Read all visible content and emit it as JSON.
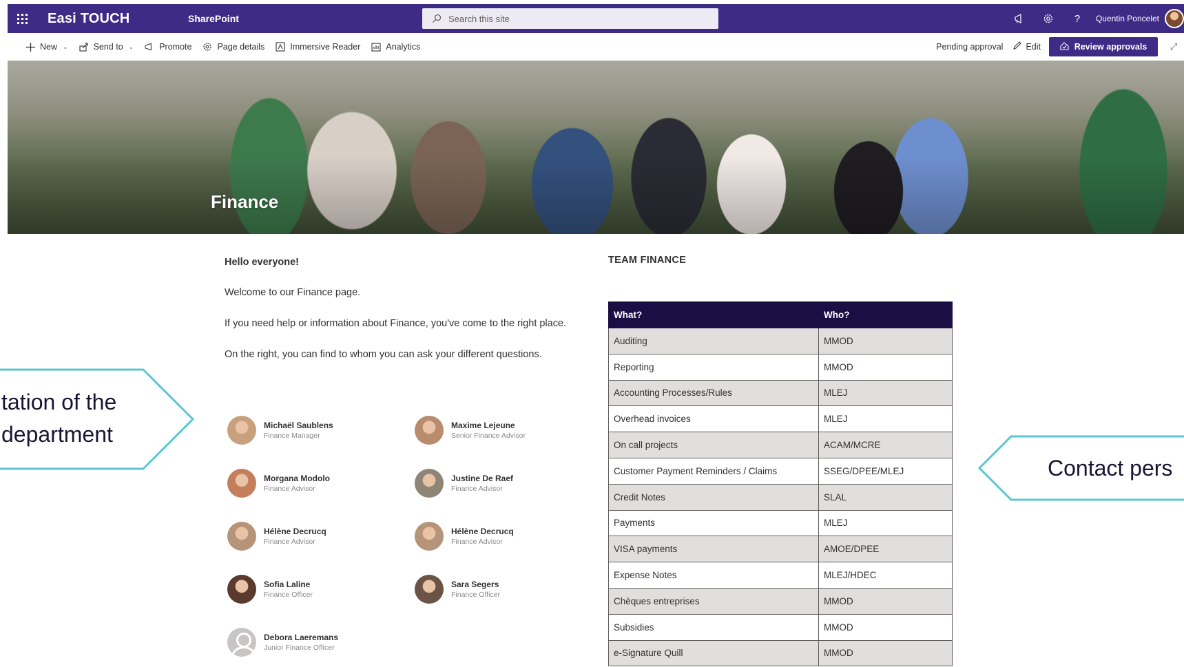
{
  "suite": {
    "brand": "Easi TOUCH",
    "app": "SharePoint",
    "search_placeholder": "Search this site",
    "user_name": "Quentin Poncelet",
    "help_label": "?"
  },
  "commands": {
    "new": "New",
    "send_to": "Send to",
    "promote": "Promote",
    "page_details": "Page details",
    "immersive_reader": "Immersive Reader",
    "analytics": "Analytics",
    "pending": "Pending approval",
    "edit": "Edit",
    "review": "Review approvals"
  },
  "hero": {
    "title": "Finance"
  },
  "intro": {
    "heading": "Hello everyone!",
    "p1": "Welcome to our Finance page.",
    "p2": "If you need help or information about Finance, you've come to the right place.",
    "p3": "On the right, you can find to whom you can ask your different questions."
  },
  "people": [
    {
      "name": "Michaël Saublens",
      "role": "Finance Manager",
      "tone": "#c9a07e"
    },
    {
      "name": "Maxime Lejeune",
      "role": "Senior Finance Advisor",
      "tone": "#b98c6e"
    },
    {
      "name": "Morgana Modolo",
      "role": "Finance Advisor",
      "tone": "#c47e5c"
    },
    {
      "name": "Justine De Raef",
      "role": "Finance Advisor",
      "tone": "#8f8576"
    },
    {
      "name": "Hélène Decrucq",
      "role": "Finance Advisor",
      "tone": "#b69479"
    },
    {
      "name": "Hélène Decrucq",
      "role": "Finance Advisor",
      "tone": "#b69479"
    },
    {
      "name": "Sofia Laline",
      "role": "Finance Officer",
      "tone": "#5a3a2c"
    },
    {
      "name": "Sara Segers",
      "role": "Finance Officer",
      "tone": "#6b5346"
    },
    {
      "name": "Debora Laeremans",
      "role": "Junior Finance Officer",
      "tone": "generic"
    }
  ],
  "team": {
    "title": "TEAM FINANCE",
    "col_what": "What?",
    "col_who": "Who?",
    "rows": [
      {
        "what": "Auditing",
        "who": "MMOD"
      },
      {
        "what": "Reporting",
        "who": "MMOD"
      },
      {
        "what": "Accounting Processes/Rules",
        "who": "MLEJ"
      },
      {
        "what": "Overhead invoices",
        "who": "MLEJ"
      },
      {
        "what": "On call projects",
        "who": "ACAM/MCRE"
      },
      {
        "what": "Customer Payment Reminders / Claims",
        "who": "SSEG/DPEE/MLEJ"
      },
      {
        "what": "Credit Notes",
        "who": "SLAL"
      },
      {
        "what": "Payments",
        "who": "MLEJ"
      },
      {
        "what": "VISA payments",
        "who": "AMOE/DPEE"
      },
      {
        "what": "Expense Notes",
        "who": "MLEJ/HDEC"
      },
      {
        "what": "Chèques entreprises",
        "who": "MMOD"
      },
      {
        "what": "Subsidies",
        "who": "MMOD"
      },
      {
        "what": "e-Signature Quill",
        "who": "MMOD"
      }
    ]
  },
  "callouts": {
    "left_line1": "tation of the",
    "left_line2": "department",
    "right_line1": "Contact pers"
  },
  "colors": {
    "suite_bar": "#3d2b86",
    "table_header": "#1a0e45",
    "callout_border": "#5cc6d0"
  }
}
